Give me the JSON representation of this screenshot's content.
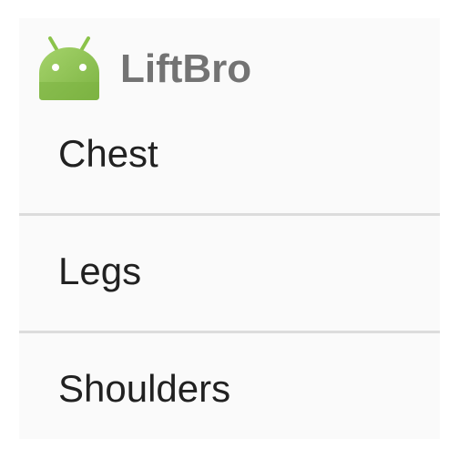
{
  "app": {
    "title": "LiftBro",
    "icon": "android-robot-icon",
    "icon_color": "#8bc34a"
  },
  "list": {
    "items": [
      {
        "label": "Chest"
      },
      {
        "label": "Legs"
      },
      {
        "label": "Shoulders"
      }
    ]
  },
  "colors": {
    "background": "#fafafa",
    "title_text": "#737373",
    "item_text": "#212121",
    "divider": "#dcdcdc"
  }
}
